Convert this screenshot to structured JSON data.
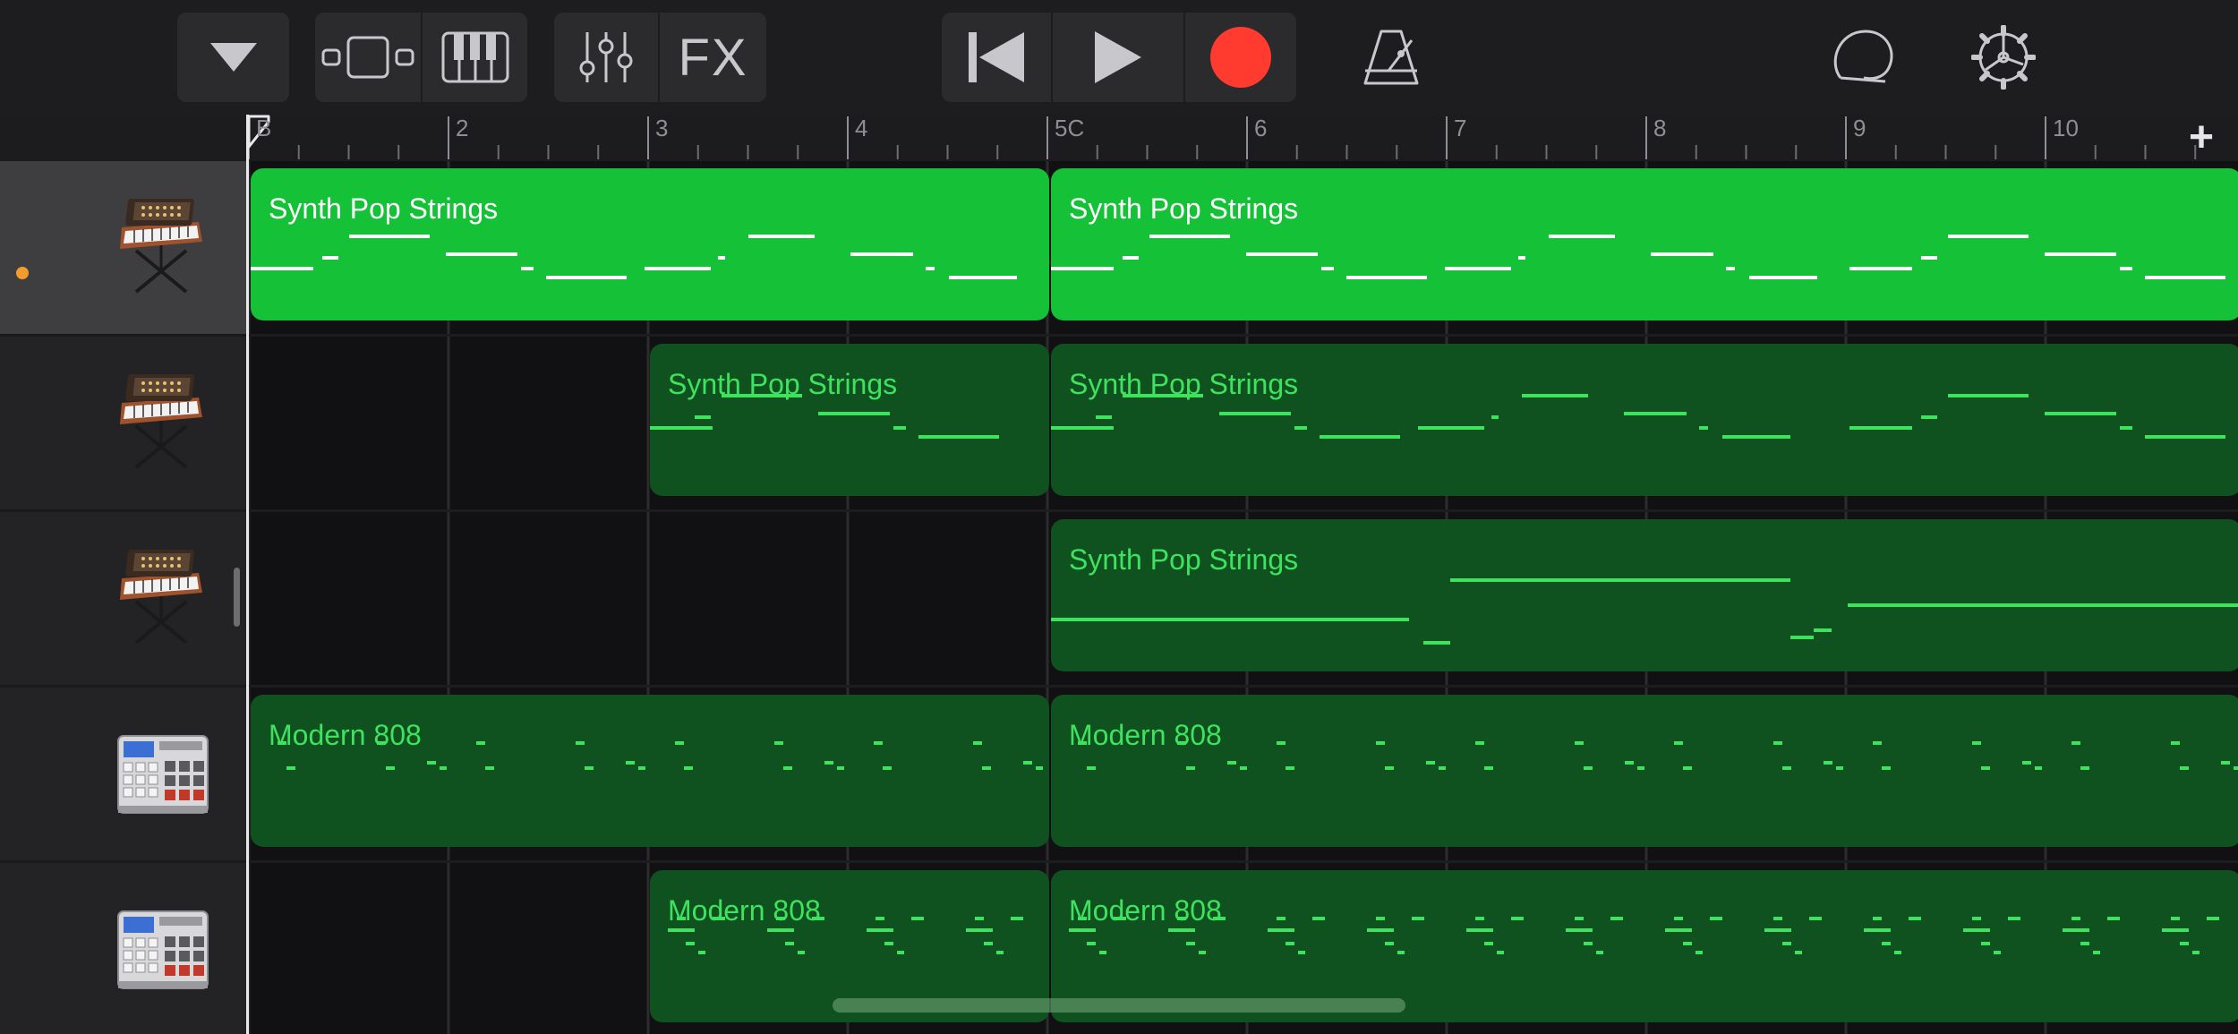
{
  "toolbar": {
    "buttons": [
      {
        "name": "track-options",
        "icon": "chevron-down-icon"
      },
      {
        "name": "tracks-view",
        "icon": "tracks-view-icon"
      },
      {
        "name": "keyboard",
        "icon": "piano-keyboard-icon"
      },
      {
        "name": "mixer",
        "icon": "sliders-icon"
      },
      {
        "name": "fx",
        "label": "FX"
      },
      {
        "name": "go-to-beginning",
        "icon": "skip-back-icon"
      },
      {
        "name": "play",
        "icon": "play-icon"
      },
      {
        "name": "record",
        "icon": "record-icon"
      },
      {
        "name": "metronome",
        "icon": "metronome-icon"
      },
      {
        "name": "loops",
        "icon": "loop-browser-icon"
      },
      {
        "name": "settings",
        "icon": "gear-icon"
      }
    ],
    "fx_label": "FX",
    "record_color": "#ff3b30"
  },
  "ruler": {
    "markers": [
      "B",
      "2",
      "3",
      "4",
      "5C",
      "6",
      "7",
      "8",
      "9",
      "10"
    ],
    "add_label": "+"
  },
  "tracks": [
    {
      "instrument": "synth-keyboard",
      "selected": true,
      "armed": true,
      "regions": [
        {
          "title": "Synth Pop Strings",
          "style": "bright"
        },
        {
          "title": "Synth Pop Strings",
          "style": "bright"
        }
      ]
    },
    {
      "instrument": "synth-keyboard",
      "selected": false,
      "armed": false,
      "regions": [
        {
          "title": "Synth Pop Strings",
          "style": "dark"
        },
        {
          "title": "Synth Pop Strings",
          "style": "dark"
        }
      ]
    },
    {
      "instrument": "synth-keyboard",
      "selected": false,
      "armed": false,
      "regions": [
        {
          "title": "Synth Pop Strings",
          "style": "dark"
        }
      ]
    },
    {
      "instrument": "drum-machine",
      "selected": false,
      "armed": false,
      "regions": [
        {
          "title": "Modern 808",
          "style": "dark"
        },
        {
          "title": "Modern 808",
          "style": "dark"
        }
      ]
    },
    {
      "instrument": "drum-machine",
      "selected": false,
      "armed": false,
      "regions": [
        {
          "title": "Modern 808",
          "style": "dark"
        },
        {
          "title": "Modern 808",
          "style": "dark"
        }
      ]
    }
  ],
  "colors": {
    "region_bright": "#14c137",
    "region_dark": "#0f5220",
    "note_on_dark": "#3ee25e",
    "note_on_bright": "#ffffff",
    "armed_dot": "#f29d2b"
  }
}
